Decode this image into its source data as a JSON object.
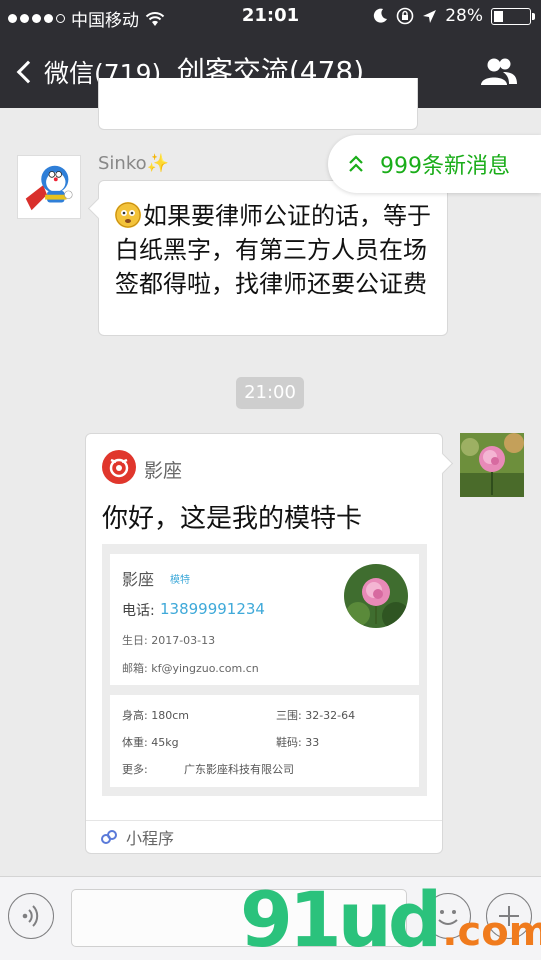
{
  "status_bar": {
    "carrier": "中国移动",
    "time": "21:01",
    "battery": "28%"
  },
  "nav": {
    "back_label": "微信(719)",
    "title": "创客交流(478)"
  },
  "chat": {
    "sender_name": "Sinko✨",
    "message_text": "如果要律师公证的话，等于白纸黑字，有第三方人员在场签都得啦，找律师还要公证费",
    "new_messages_label": "999条新消息",
    "timestamp": "21:00"
  },
  "card": {
    "app_name": "影座",
    "title": "你好，这是我的模特卡",
    "preview": {
      "name": "影座",
      "tag": "模特",
      "phone_label": "电话:",
      "phone": "13899991234",
      "birthday": "生日: 2017-03-13",
      "email": "邮箱: kf@yingzuo.com.cn",
      "height": "身高: 180cm",
      "measurements": "三围: 32-32-64",
      "weight": "体重: 45kg",
      "shoe": "鞋码: 33",
      "more_label": "更多:",
      "company": "广东影座科技有限公司"
    },
    "footer_label": "小程序"
  },
  "watermark": {
    "main": "91ud",
    "tail": ".com"
  },
  "colors": {
    "nav_bg": "#2e2e33",
    "accent_green": "#1aad19",
    "link_blue": "#3fa9d9"
  }
}
